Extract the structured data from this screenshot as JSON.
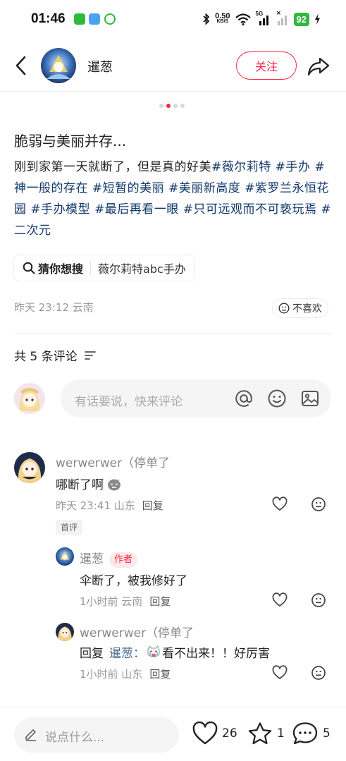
{
  "status_bar": {
    "time": "01:46",
    "net_speed_value": "0.50",
    "net_speed_unit": "KB/S",
    "network_label": "5G",
    "battery": "92"
  },
  "header": {
    "author_name": "暹葱",
    "follow_label": "关注"
  },
  "carousel": {
    "count": 4,
    "active_index": 1
  },
  "post": {
    "title": "脆弱与美丽并存...",
    "body_text": "刚到家第一天就断了，但是真的好美",
    "hashtags": [
      "#薇尔莉特",
      "#手办",
      "#神一般的存在",
      "#短暂的美丽",
      "#美丽新高度",
      "#紫罗兰永恒花园",
      "#手办模型",
      "#最后再看一眼",
      "#只可远观而不可亵玩焉",
      "#二次元"
    ],
    "guess_label": "猜你想搜",
    "guess_query": "薇尔莉特abc手办",
    "meta": "昨天 23:12 云南",
    "dislike_label": "不喜欢"
  },
  "comments_section": {
    "count_label": "共 5 条评论",
    "input_placeholder": "有话要说，快来评论"
  },
  "comments": [
    {
      "name": "werwerwer（停单了",
      "text": "哪断了啊",
      "meta": "昨天 23:41 山东",
      "reply_label": "回复",
      "badge": "首评"
    },
    {
      "name": "暹葱",
      "author_badge": "作者",
      "text": "伞断了，被我修好了",
      "meta": "1小时前 云南",
      "reply_label": "回复"
    },
    {
      "name": "werwerwer（停单了",
      "reply_prefix": "回复",
      "mention": "暹葱：",
      "text": "看不出来！！好厉害",
      "meta": "1小时前 山东",
      "reply_label": "回复"
    }
  ],
  "bottom_bar": {
    "input_placeholder": "说点什么...",
    "likes": "26",
    "collects": "1",
    "comments": "5"
  },
  "colors": {
    "brand": "#ff2442",
    "hashtag": "#13386c",
    "battery": "#2fb93e"
  }
}
